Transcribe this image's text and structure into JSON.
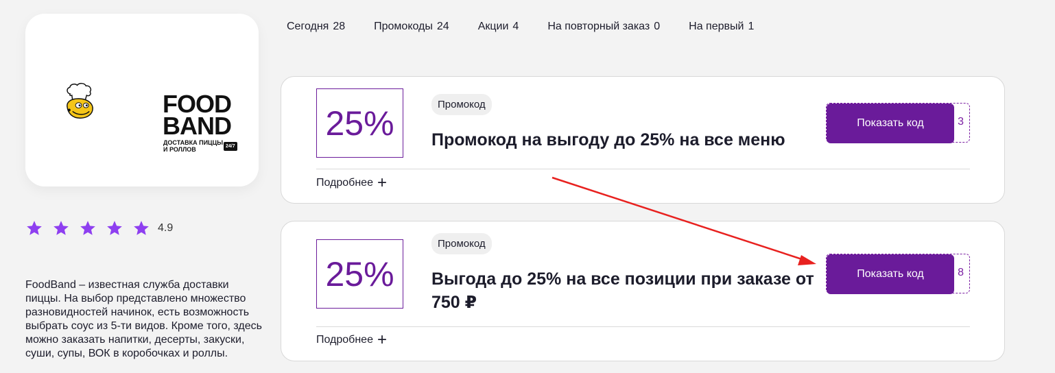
{
  "tabs": [
    {
      "label": "Сегодня",
      "count": "28"
    },
    {
      "label": "Промокоды",
      "count": "24"
    },
    {
      "label": "Акции",
      "count": "4"
    },
    {
      "label": "На повторный заказ",
      "count": "0"
    },
    {
      "label": "На первый",
      "count": "1"
    }
  ],
  "brand": {
    "line1": "FOOD",
    "line2": "BAND",
    "subtitle": "Доставка пиццы и роллов",
    "badge": "24/7"
  },
  "rating": {
    "value": "4.9",
    "stars": 5
  },
  "description": "FoodBand – известная служба доставки пиццы. На выбор представлено множество разновидностей начинок, есть возможность выбрать соус из 5-ти видов. Кроме того, здесь можно заказать напитки, десерты, закуски, суши, супы, ВОК в коробочках и роллы.",
  "coupons": [
    {
      "discount": "25%",
      "type": "Промокод",
      "title": "Промокод на выгоду до 25% на все меню",
      "button": "Показать код",
      "code_tail": "3",
      "more": "Подробнее"
    },
    {
      "discount": "25%",
      "type": "Промокод",
      "title": "Выгода до 25% на все позиции при заказе от 750 ₽",
      "button": "Показать код",
      "code_tail": "8",
      "more": "Подробнее"
    }
  ],
  "colors": {
    "accent": "#6a1b9a",
    "star": "#8e3ff0",
    "arrow": "#e8211f"
  }
}
